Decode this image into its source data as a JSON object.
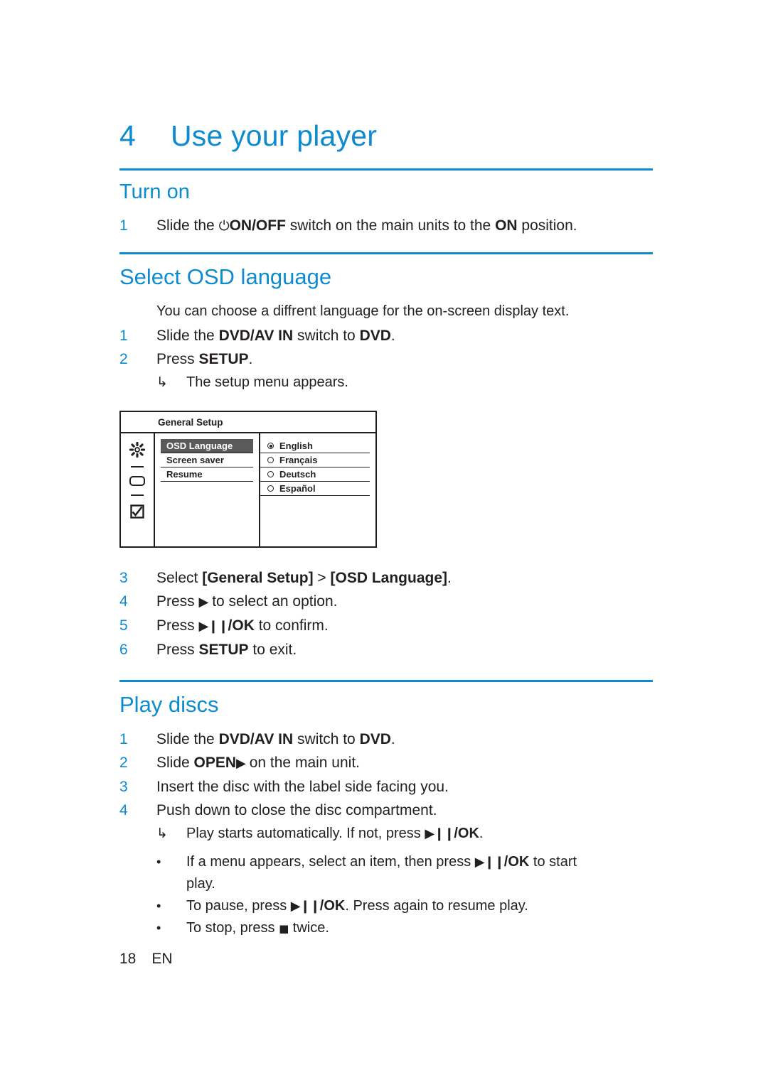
{
  "chapter": {
    "number": "4",
    "title": "Use your player"
  },
  "sections": {
    "turn_on": {
      "heading": "Turn on",
      "steps": [
        {
          "n": "1",
          "pre": "Slide the ",
          "glyph": "power",
          "bold1": "ON/OFF",
          "mid": " switch on the main units to the ",
          "bold2": "ON",
          "post": " position."
        }
      ]
    },
    "select_osd": {
      "heading": "Select OSD language",
      "intro": "You can choose a diffrent language for the on-screen display text.",
      "step1": {
        "n": "1",
        "pre": "Slide the ",
        "bold1": "DVD/AV IN",
        "mid": " switch to ",
        "bold2": "DVD",
        "post": "."
      },
      "step2": {
        "n": "2",
        "pre": "Press ",
        "bold1": "SETUP",
        "post": "."
      },
      "sub1": {
        "arrow": "↳",
        "text": "The setup menu appears."
      },
      "step3": {
        "n": "3",
        "pre": "Select ",
        "bold1": "[General Setup]",
        "mid": " > ",
        "bold2": "[OSD Language]",
        "post": "."
      },
      "step4": {
        "n": "4",
        "pre": "Press ",
        "glyph": "▶",
        "post": " to select an option."
      },
      "step5": {
        "n": "5",
        "pre": "Press ",
        "glyph": "▶❙❙",
        "bold1": "/OK",
        "post": " to confirm."
      },
      "step6": {
        "n": "6",
        "pre": "Press ",
        "bold1": "SETUP",
        "post": " to exit."
      }
    },
    "play_discs": {
      "heading": "Play discs",
      "step1": {
        "n": "1",
        "pre": "Slide the ",
        "bold1": "DVD/AV IN",
        "mid": " switch to ",
        "bold2": "DVD",
        "post": "."
      },
      "step2": {
        "n": "2",
        "pre": "Slide ",
        "bold1": "OPEN",
        "glyph": "▶",
        "post": " on the main unit."
      },
      "step3": {
        "n": "3",
        "text": "Insert the disc with the label side facing you."
      },
      "step4": {
        "n": "4",
        "text": "Push down to close the disc compartment."
      },
      "sub1": {
        "arrow": "↳",
        "pre": "Play starts automatically. If not, press ",
        "glyph": "▶❙❙",
        "bold1": "/OK",
        "post": "."
      },
      "bullet1": {
        "dot": "•",
        "pre": "If a menu appears, select an item, then press ",
        "glyph": "▶❙❙",
        "bold1": "/OK",
        "post": " to start"
      },
      "bullet1_cont": "play.",
      "bullet2": {
        "dot": "•",
        "pre": "To pause, press ",
        "glyph": "▶❙❙",
        "bold1": "/OK",
        "post": ". Press again to resume play."
      },
      "bullet3": {
        "dot": "•",
        "pre": "To stop, press ",
        "glyph": "■",
        "post": " twice."
      }
    }
  },
  "osd_screen": {
    "title": "General Setup",
    "menu": [
      {
        "label": "OSD Language",
        "selected": true
      },
      {
        "label": "Screen saver",
        "selected": false
      },
      {
        "label": "Resume",
        "selected": false
      }
    ],
    "options": [
      {
        "label": "English",
        "selected": true
      },
      {
        "label": "Français",
        "selected": false
      },
      {
        "label": "Deutsch",
        "selected": false
      },
      {
        "label": "Español",
        "selected": false
      }
    ],
    "icons": [
      "gear-icon",
      "divider-icon",
      "disc-icon",
      "divider-icon",
      "checkbox-icon"
    ]
  },
  "footer": {
    "page": "18",
    "lang": "EN"
  },
  "colors": {
    "accent": "#0d8bd1",
    "text": "#231f20"
  }
}
